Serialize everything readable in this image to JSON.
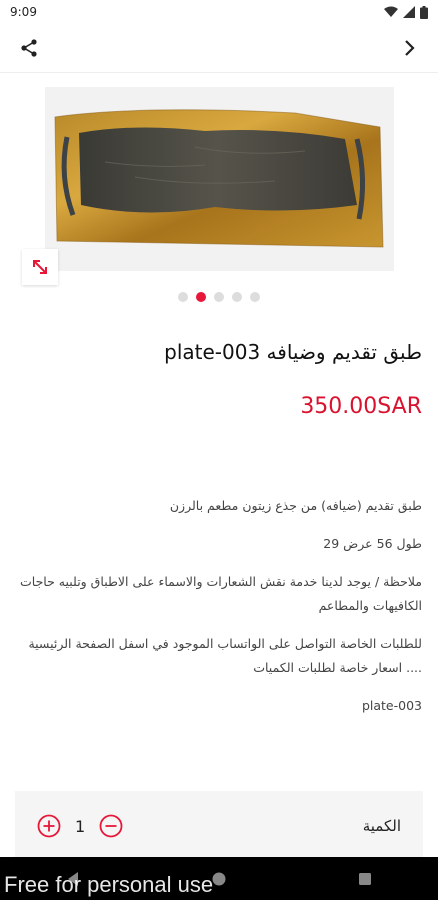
{
  "status_bar": {
    "time": "9:09",
    "icons": [
      "wifi-icon",
      "signal-icon",
      "battery-icon"
    ]
  },
  "top_bar": {
    "left_icon": "share-icon",
    "right_icon": "chevron-right-icon"
  },
  "product": {
    "image_alt": "wooden serving tray with resin",
    "gallery_dots": 5,
    "active_dot": 1,
    "title": "طبق تقديم وضيافه plate-003",
    "price": "350.00SAR",
    "description": [
      "طبق تقديم (ضيافه) من جذع زيتون مطعم بالرزن",
      "طول 56 عرض 29",
      "ملاحظة / يوجد لدينا خدمة نقش الشعارات والاسماء على الاطباق وتلبيه حاجات الكافيهات والمطاعم",
      "للطلبات الخاصة التواصل على الواتساب الموجود في اسفل الصفحة الرئيسية .... اسعار خاصة لطلبات الكميات",
      "plate-003"
    ]
  },
  "quantity": {
    "label": "الكمية",
    "value": "1"
  },
  "colors": {
    "accent": "#e8173a",
    "price": "#d9122f"
  },
  "watermark": "Free for personal use"
}
